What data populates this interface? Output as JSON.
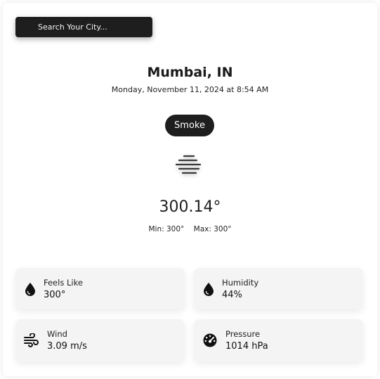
{
  "search": {
    "placeholder": "Search Your City..."
  },
  "location": {
    "city": "Mumbai, IN",
    "datetime": "Monday, November 11, 2024 at 8:54 AM"
  },
  "condition": {
    "label": "Smoke",
    "icon": "smoke-haze-icon"
  },
  "temperature": {
    "current": "300.14°",
    "min": "Min: 300°",
    "max": "Max: 300°"
  },
  "details": {
    "feels_like": {
      "label": "Feels Like",
      "value": "300°",
      "icon": "droplet-icon"
    },
    "humidity": {
      "label": "Humidity",
      "value": "44%",
      "icon": "droplet-icon"
    },
    "wind": {
      "label": "Wind",
      "value": "3.09 m/s",
      "icon": "wind-icon"
    },
    "pressure": {
      "label": "Pressure",
      "value": "1014 hPa",
      "icon": "gauge-icon"
    }
  },
  "colors": {
    "dark": "#1e1e1e",
    "tile_bg": "#f4f4f4",
    "page_bg": "#ffffff"
  }
}
